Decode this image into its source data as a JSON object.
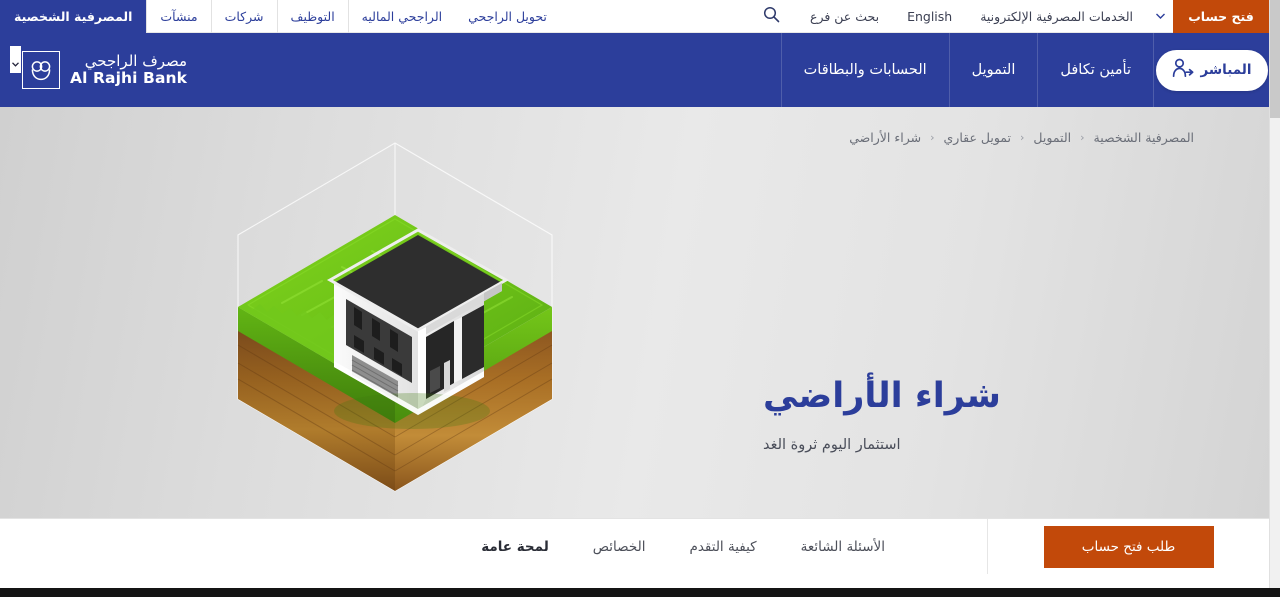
{
  "topbar": {
    "open_account_label": "فتح حساب",
    "dropdown_icon": "chevron-down-icon",
    "ebanking_label": "الخدمات المصرفية الإلكترونية",
    "language_label": "English",
    "find_branch_label": "بحث عن فرع",
    "search_icon": "search-icon",
    "segments": [
      {
        "label": "تحويل الراجحي",
        "active": false
      },
      {
        "label": "الراجحي الماليه",
        "active": false
      },
      {
        "label": "التوظيف",
        "active": false
      },
      {
        "label": "شركات",
        "active": false
      },
      {
        "label": "منشآت",
        "active": false
      },
      {
        "label": "المصرفية الشخصية",
        "active": true
      }
    ]
  },
  "mainnav": {
    "pill": {
      "label": "المباشر",
      "icon": "user-login-icon"
    },
    "items": [
      {
        "label": "تأمين تكافل"
      },
      {
        "label": "التمويل"
      },
      {
        "label": "الحسابات والبطاقات"
      }
    ],
    "brand": {
      "arabic": "مصرف الراجحي",
      "english": "Al Rajhi Bank",
      "mark_icon": "al-rajhi-logo-mark"
    },
    "artifact_icon": "chevron-down-icon"
  },
  "breadcrumb": [
    {
      "label": "المصرفية الشخصية"
    },
    {
      "label": "التمويل"
    },
    {
      "label": "تمويل عقاري"
    },
    {
      "label": "شراء الأراضي"
    }
  ],
  "breadcrumb_separator": "‹",
  "hero": {
    "title": "شراء الأراضي",
    "subtitle": "استثمار اليوم ثروة الغد",
    "illustration_name": "isometric-house-on-land-illustration"
  },
  "tabbar": {
    "cta_label": "طلب فتح حساب",
    "tabs": [
      {
        "label": "الأسئلة الشائعة",
        "active": false
      },
      {
        "label": "كيفية التقدم",
        "active": false
      },
      {
        "label": "الخصائص",
        "active": false
      },
      {
        "label": "لمحة عامة",
        "active": true
      }
    ]
  },
  "colors": {
    "brand_blue": "#2c3e9b",
    "accent_orange": "#c2490a",
    "hero_bg_light": "#e9e9e9",
    "hero_bg_dark": "#d0d0d0",
    "text_muted": "#6a6e78"
  }
}
